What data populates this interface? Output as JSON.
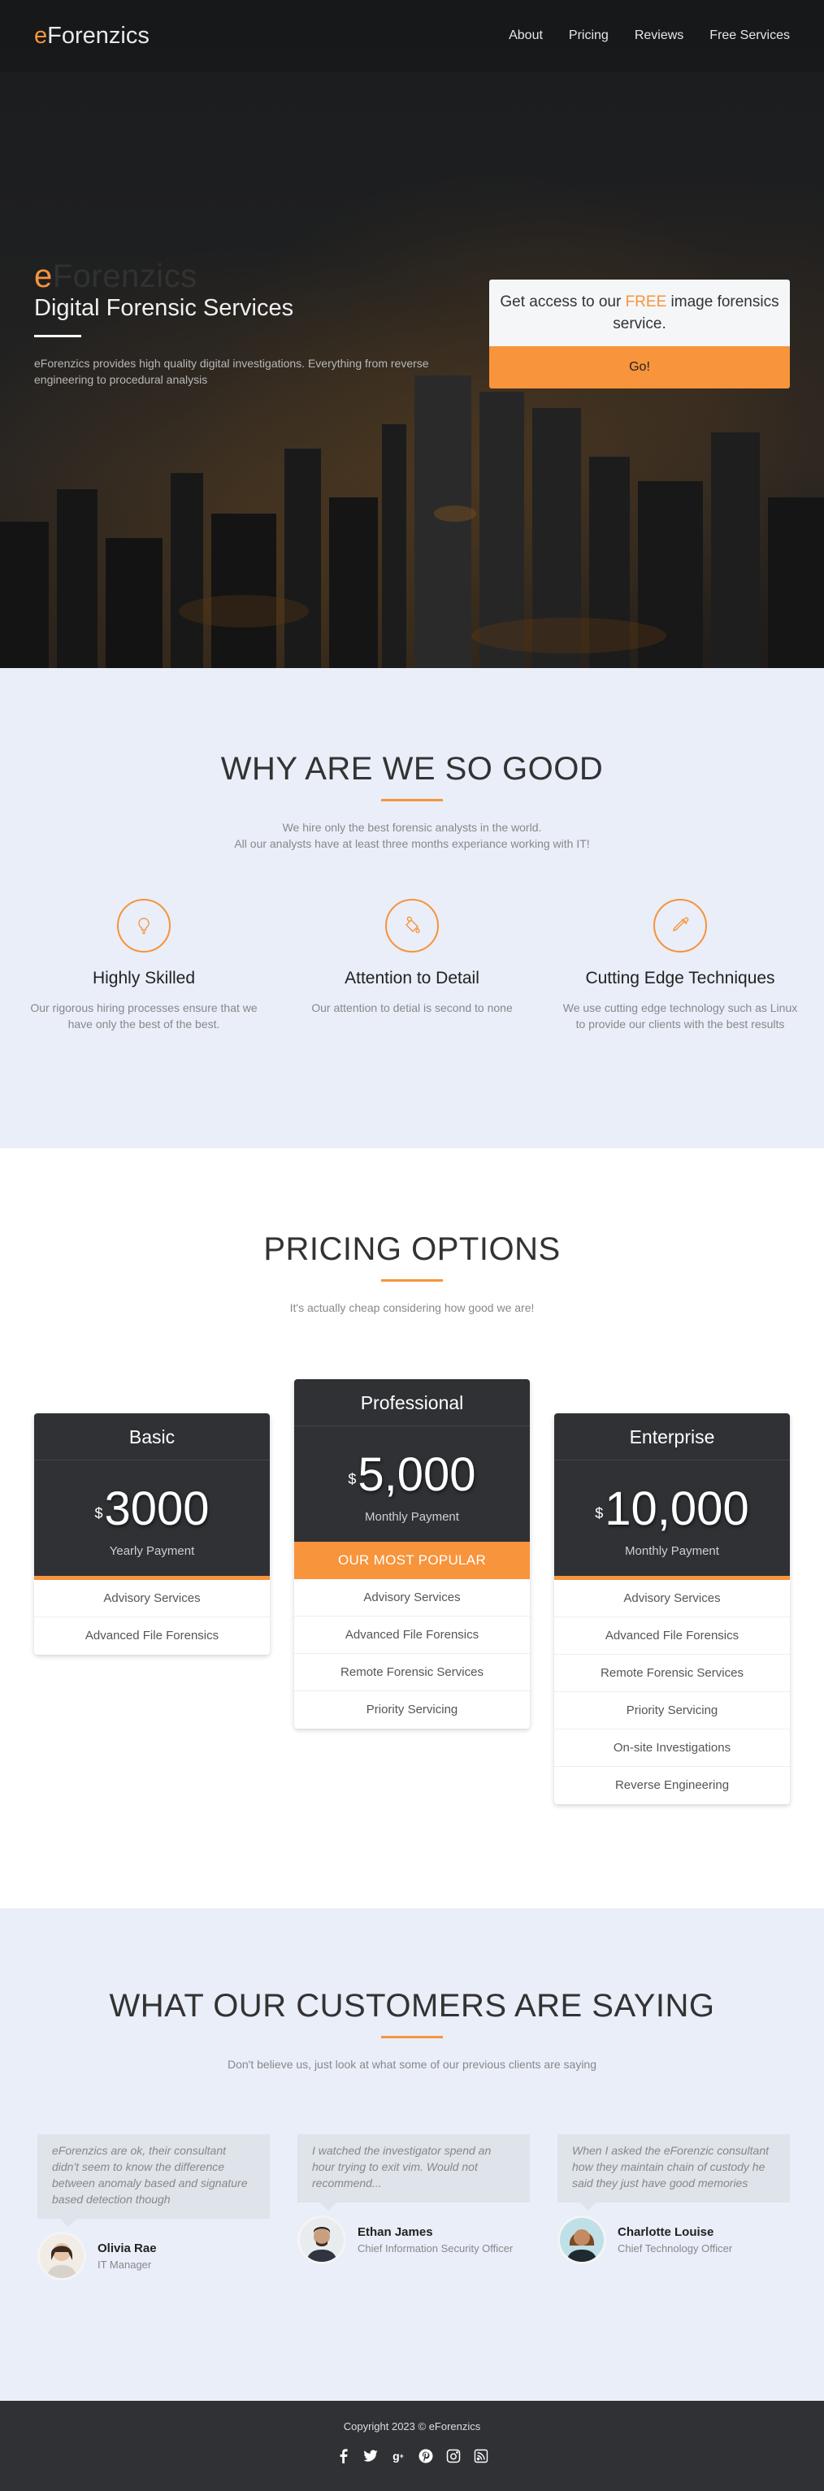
{
  "nav": {
    "brand_e": "e",
    "brand_rest": "Forenzics",
    "links": [
      "About",
      "Pricing",
      "Reviews",
      "Free Services"
    ]
  },
  "hero": {
    "brand_e": "e",
    "brand_rest": "Forenzics",
    "subtitle": "Digital Forensic Services",
    "description": "eForenzics provides high quality digital investigations. Everything from reverse engineering to procedural analysis",
    "cta_prefix": "Get access to our ",
    "cta_free": "FREE",
    "cta_suffix": " image forensics service.",
    "cta_button": "Go!"
  },
  "why": {
    "title": "WHY ARE WE SO GOOD",
    "sub_line1": "We hire only the best forensic analysts in the world.",
    "sub_line2": "All our analysts have at least three months experiance working with IT!",
    "features": [
      {
        "icon": "lightbulb-icon",
        "title": "Highly Skilled",
        "text": "Our rigorous hiring processes ensure that we have only the best of the best."
      },
      {
        "icon": "paint-bucket-icon",
        "title": "Attention to Detail",
        "text": "Our attention to detial is second to none"
      },
      {
        "icon": "eyedropper-icon",
        "title": "Cutting Edge Techniques",
        "text": "We use cutting edge technology such as Linux to provide our clients with the best results"
      }
    ]
  },
  "pricing": {
    "title": "PRICING OPTIONS",
    "subtitle": "It's actually cheap considering how good we are!",
    "plans": [
      {
        "name": "Basic",
        "currency": "$",
        "amount": "3000",
        "period": "Yearly Payment",
        "popular": "",
        "features": [
          "Advisory Services",
          "Advanced File Forensics"
        ]
      },
      {
        "name": "Professional",
        "currency": "$",
        "amount": "5,000",
        "period": "Monthly Payment",
        "popular": "OUR MOST POPULAR",
        "features": [
          "Advisory Services",
          "Advanced File Forensics",
          "Remote Forensic Services",
          "Priority Servicing"
        ]
      },
      {
        "name": "Enterprise",
        "currency": "$",
        "amount": "10,000",
        "period": "Monthly Payment",
        "popular": "",
        "features": [
          "Advisory Services",
          "Advanced File Forensics",
          "Remote Forensic Services",
          "Priority Servicing",
          "On-site Investigations",
          "Reverse Engineering"
        ]
      }
    ]
  },
  "reviews": {
    "title": "WHAT OUR CUSTOMERS ARE SAYING",
    "subtitle": "Don't believe us, just look at what some of our previous clients are saying",
    "items": [
      {
        "quote": "eForenzics are ok, their consultant didn't seem to know the difference between anomaly based and signature based detection though",
        "name": "Olivia Rae",
        "role": "IT Manager"
      },
      {
        "quote": "I watched the investigator spend an hour trying to exit vim. Would not recommend...",
        "name": "Ethan James",
        "role": "Chief Information Security Officer"
      },
      {
        "quote": "When I asked the eForenzic consultant how they maintain chain of custody he said they just have good memories",
        "name": "Charlotte Louise",
        "role": "Chief Technology Officer"
      }
    ]
  },
  "footer": {
    "copyright": "Copyright 2023 © eForenzics",
    "social": [
      "facebook-icon",
      "twitter-icon",
      "google-plus-icon",
      "pinterest-icon",
      "instagram-icon",
      "rss-icon"
    ]
  },
  "colors": {
    "accent": "#f7943c",
    "dark": "#2f3135",
    "section_bg": "#e9eef9"
  }
}
